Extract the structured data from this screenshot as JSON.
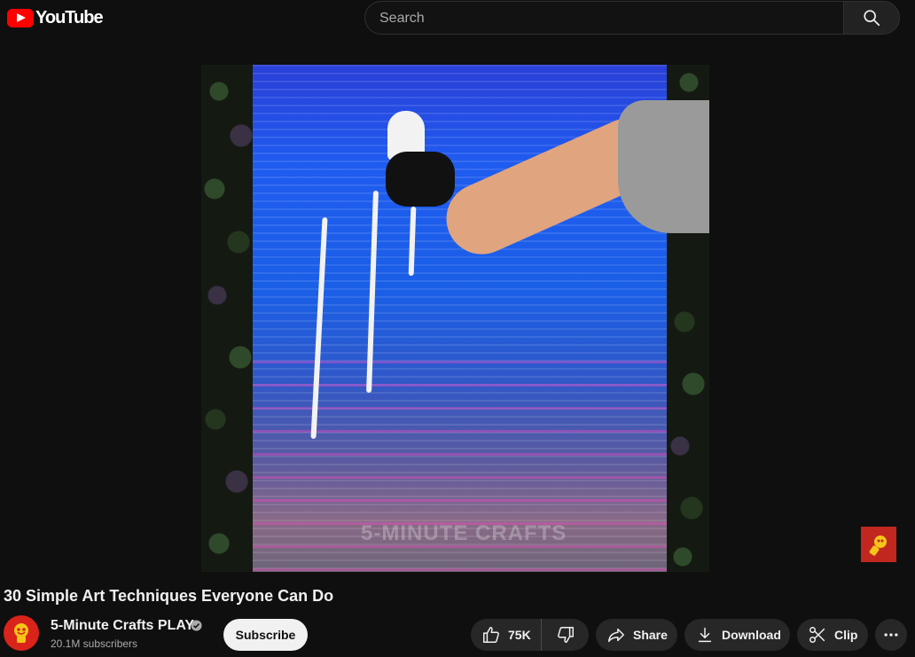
{
  "header": {
    "logo_text": "YouTube",
    "search_placeholder": "Search"
  },
  "video": {
    "watermark": "5-MINUTE CRAFTS",
    "title": "30 Simple Art Techniques Everyone Can Do"
  },
  "channel": {
    "name": "5-Minute Crafts PLAY",
    "subscribers": "20.1M subscribers",
    "subscribe_label": "Subscribe"
  },
  "actions": {
    "like_count": "75K",
    "share_label": "Share",
    "download_label": "Download",
    "clip_label": "Clip"
  },
  "colors": {
    "background": "#0f0f0f",
    "brand_red": "#ff0000",
    "pill": "#272727"
  }
}
